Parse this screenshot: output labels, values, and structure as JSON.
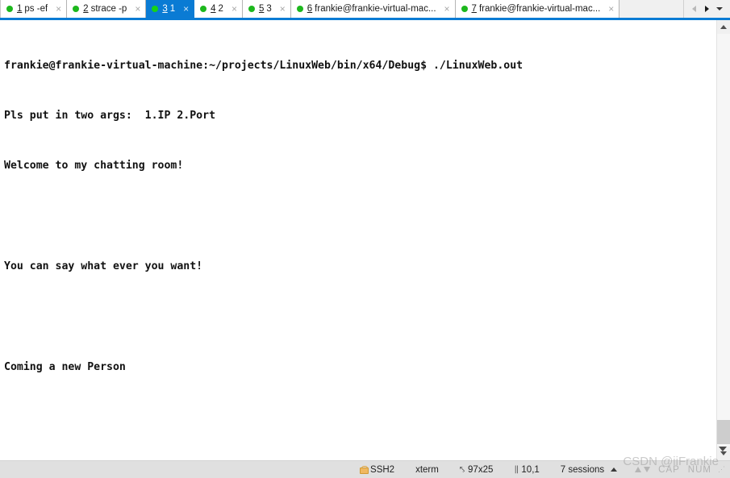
{
  "tabbar": {
    "tabs": [
      {
        "num": "1",
        "title": "ps -ef",
        "active": false,
        "dot": "green-status-dot",
        "close": "×"
      },
      {
        "num": "2",
        "title": "strace -p",
        "active": false,
        "dot": "green-status-dot",
        "close": "×"
      },
      {
        "num": "3",
        "title": "1",
        "active": true,
        "dot": "green-status-dot",
        "close": "×"
      },
      {
        "num": "4",
        "title": "2",
        "active": false,
        "dot": "green-status-dot",
        "close": "×"
      },
      {
        "num": "5",
        "title": "3",
        "active": false,
        "dot": "green-status-dot",
        "close": "×"
      },
      {
        "num": "6",
        "title": "frankie@frankie-virtual-mac...",
        "active": false,
        "dot": "green-status-dot",
        "close": "×"
      },
      {
        "num": "7",
        "title": "frankie@frankie-virtual-mac...",
        "active": false,
        "dot": "green-status-dot",
        "close": "×"
      }
    ],
    "nav": {
      "prev_icon": "triangle-left-icon",
      "next_icon": "triangle-right-icon",
      "list_icon": "chevron-down-icon"
    },
    "accent_color": "#0a7bd4"
  },
  "terminal": {
    "lines": [
      "frankie@frankie-virtual-machine:~/projects/LinuxWeb/bin/x64/Debug$ ./LinuxWeb.out",
      "Pls put in two args:  1.IP 2.Port",
      "Welcome to my chatting room!",
      "",
      "You can say what ever you want!",
      "",
      "Coming a new Person",
      ""
    ],
    "cursor_color": "#00f000",
    "background_color": "#ffffff",
    "text_color": "#111111"
  },
  "scrollbar": {
    "up_icon": "chevron-up-icon",
    "down_icon": "chevron-down-icon",
    "thumb_color": "#cdcdcd"
  },
  "statusbar": {
    "security": {
      "icon": "lock-icon",
      "label": "SSH2"
    },
    "terminal_type": {
      "label": "xterm"
    },
    "dimensions": {
      "icon": "resize-icon",
      "glyph": "⤣",
      "label": "97x25"
    },
    "cursor_position": {
      "icon": "cursor-position-icon",
      "glyph": "‖",
      "label": "10,1"
    },
    "sessions": {
      "label": "7 sessions",
      "arrow_icon": "triangle-up-icon"
    },
    "indicators": {
      "up_icon": "arrow-up-icon",
      "down_icon": "arrow-down-icon",
      "caps_lock": "CAP",
      "num_lock": "NUM"
    },
    "resize_grip": "resize-grip-icon"
  },
  "watermark": {
    "text": "CSDN @iiFrankie"
  }
}
